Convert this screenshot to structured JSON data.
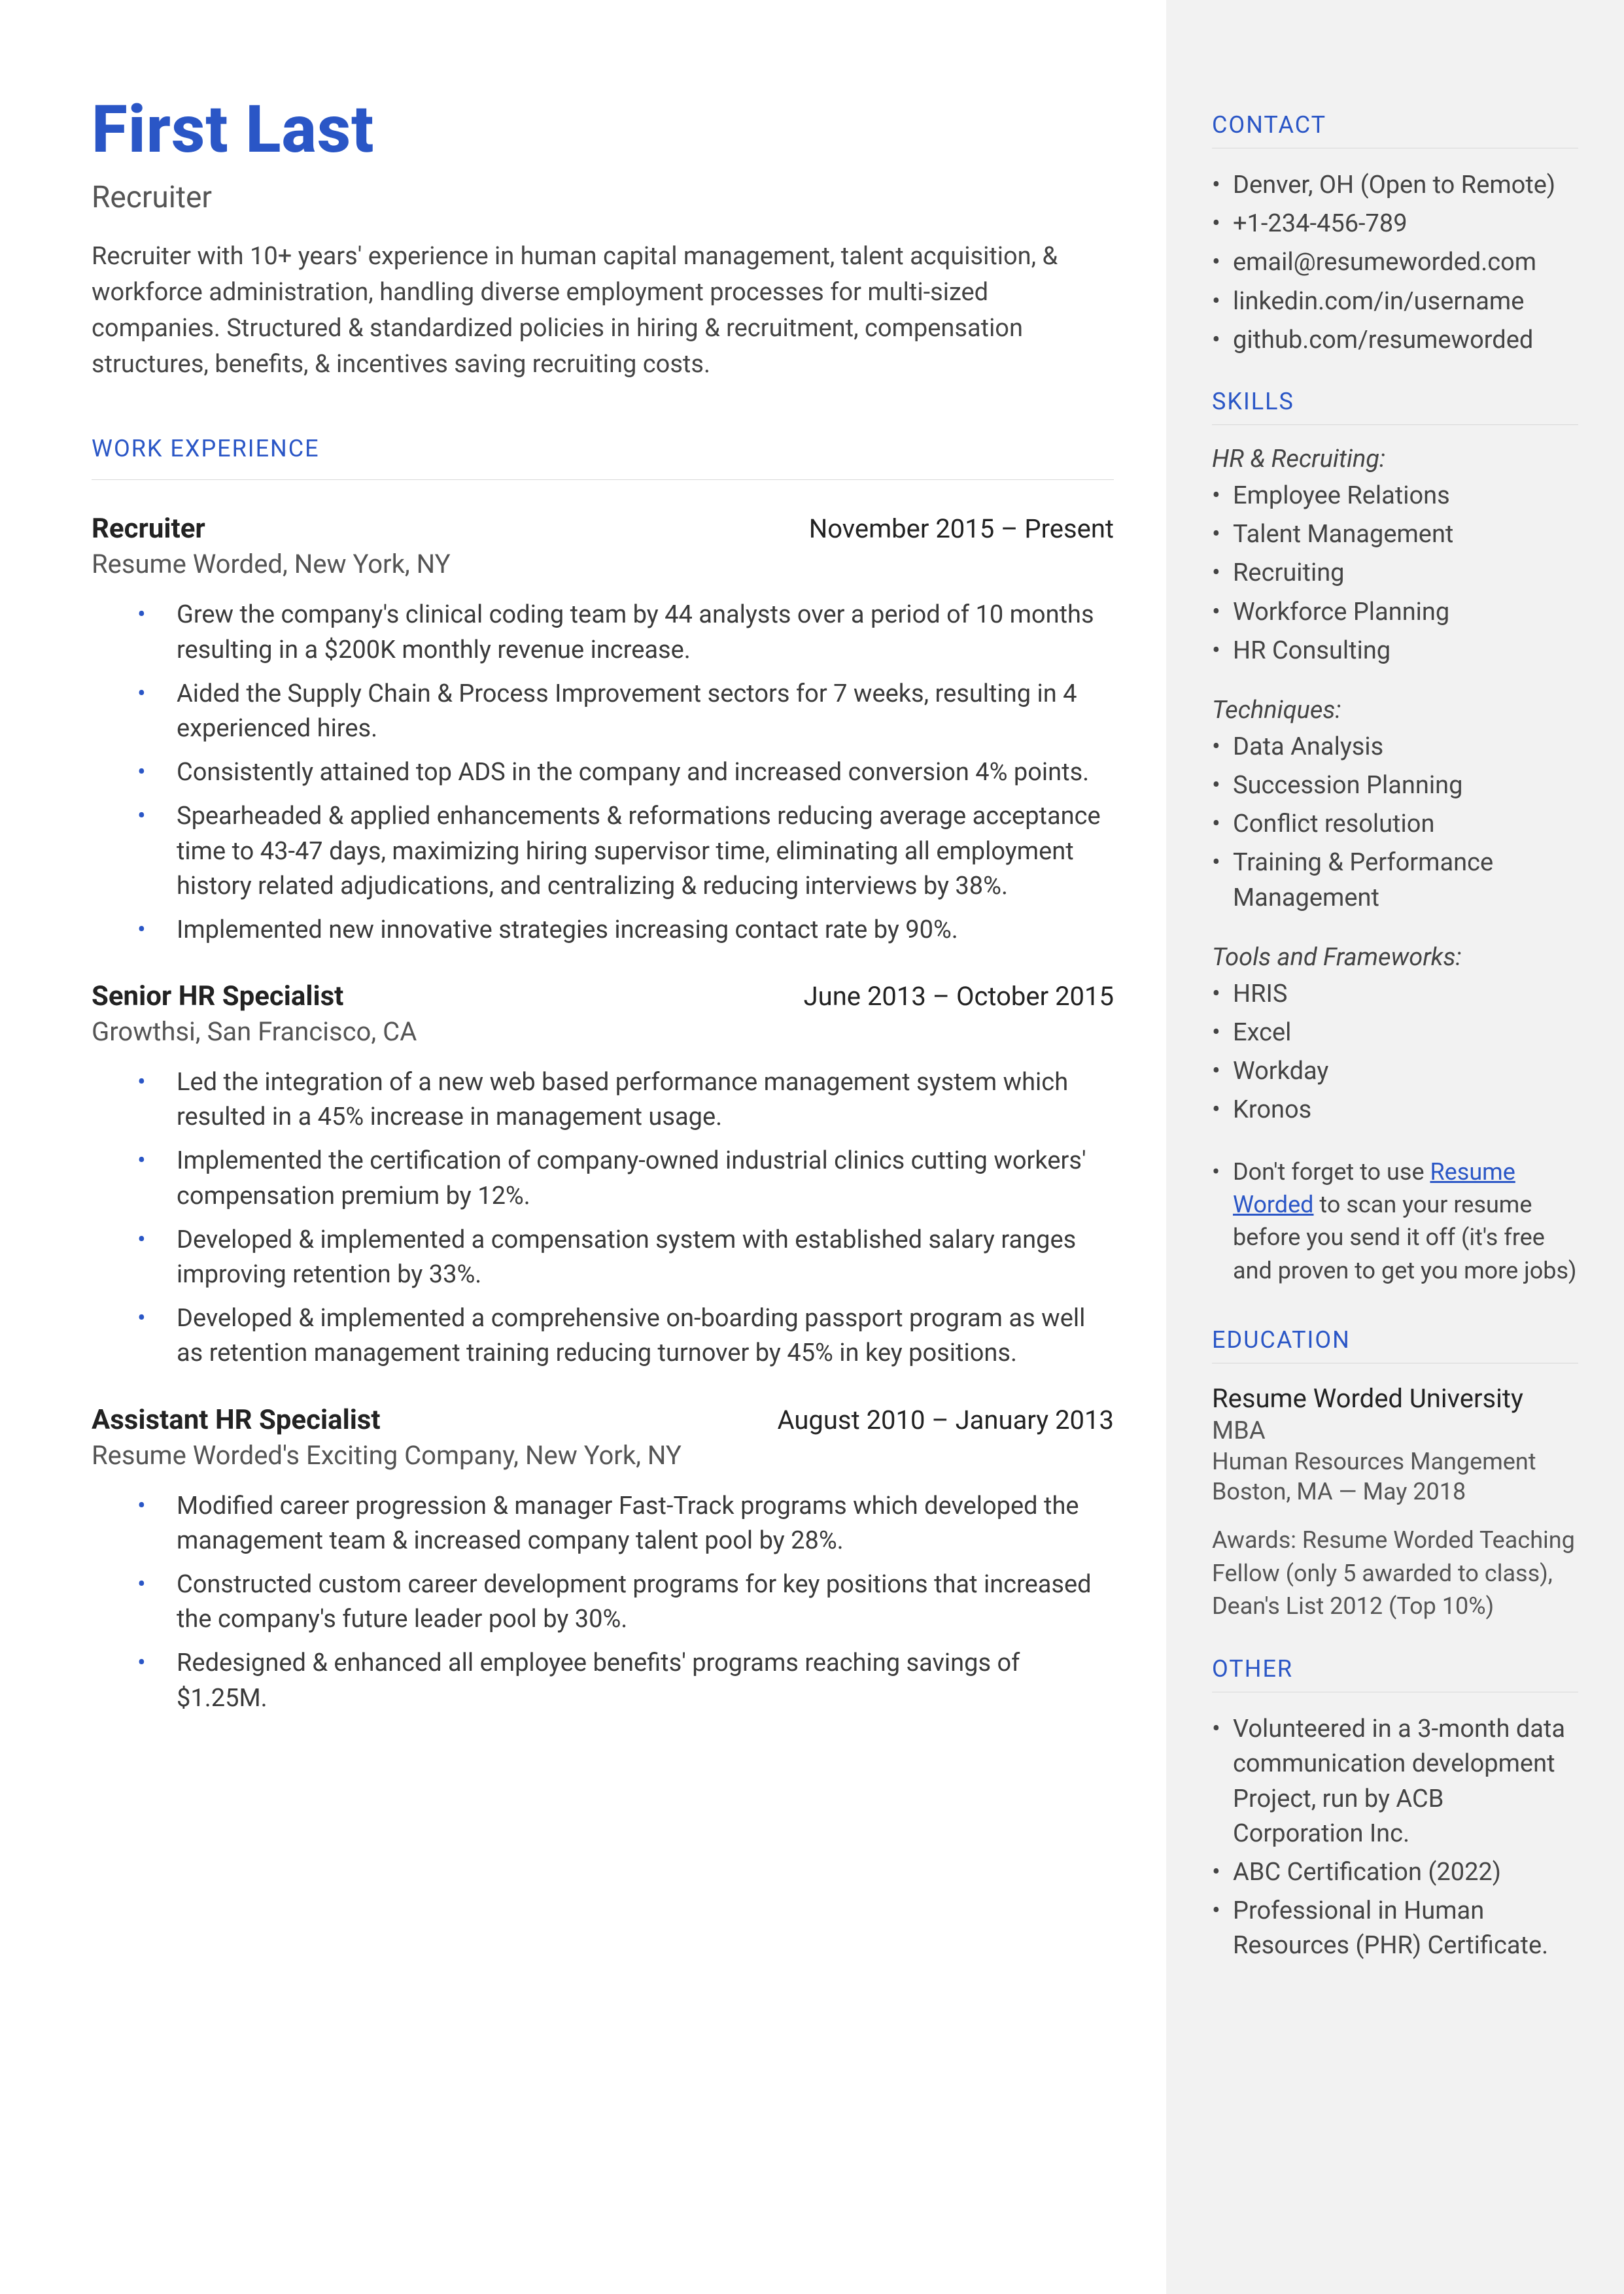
{
  "header": {
    "name": "First Last",
    "role": "Recruiter",
    "summary": "Recruiter with 10+ years' experience in human capital management, talent acquisition, & workforce administration, handling diverse employment processes for multi-sized companies. Structured & standardized policies in hiring & recruitment, compensation structures, benefits, & incentives saving recruiting costs."
  },
  "headings": {
    "work": "WORK EXPERIENCE",
    "contact": "CONTACT",
    "skills": "SKILLS",
    "education": "EDUCATION",
    "other": "OTHER"
  },
  "jobs": [
    {
      "title": "Recruiter",
      "dates": "November 2015 – Present",
      "company": "Resume Worded, New York, NY",
      "bullets": [
        "Grew the company's clinical coding team by 44 analysts over a period of 10 months resulting in a $200K monthly revenue increase.",
        "Aided the Supply Chain & Process Improvement sectors for 7 weeks, resulting in 4 experienced hires.",
        "Consistently attained top ADS in the company and increased conversion 4% points.",
        "Spearheaded & applied enhancements & reformations reducing average acceptance time to 43-47 days, maximizing hiring supervisor time, eliminating all employment history related adjudications, and centralizing & reducing interviews by 38%.",
        "Implemented new innovative strategies increasing contact rate by 90%."
      ]
    },
    {
      "title": "Senior HR Specialist",
      "dates": "June 2013 – October 2015",
      "company": "Growthsi, San Francisco, CA",
      "bullets": [
        "Led the integration of a new web based performance management system which resulted in a 45% increase in management usage.",
        "Implemented the certification of company-owned industrial clinics cutting workers' compensation premium by 12%.",
        "Developed & implemented a compensation system with established salary ranges improving retention by 33%.",
        "Developed & implemented a comprehensive on-boarding passport program as well as retention management training reducing turnover by 45% in key positions."
      ]
    },
    {
      "title": "Assistant HR Specialist",
      "dates": "August 2010 – January 2013",
      "company": "Resume Worded's Exciting Company, New York, NY",
      "bullets": [
        "Modified career progression & manager Fast-Track programs which developed the management team & increased company talent pool by 28%.",
        "Constructed custom career development programs for key positions that increased the company's future leader pool by 30%.",
        "Redesigned & enhanced all employee benefits' programs reaching savings of $1.25M."
      ]
    }
  ],
  "contact": [
    "Denver, OH (Open to Remote)",
    "+1-234-456-789",
    "email@resumeworded.com",
    "linkedin.com/in/username",
    "github.com/resumeworded"
  ],
  "skills": {
    "groups": [
      {
        "label": "HR & Recruiting:",
        "items": [
          "Employee Relations",
          "Talent Management",
          "Recruiting",
          "Workforce Planning",
          "HR Consulting"
        ]
      },
      {
        "label": "Techniques:",
        "items": [
          "Data Analysis",
          "Succession Planning",
          "Conflict resolution",
          "Training & Performance Management"
        ]
      },
      {
        "label": "Tools and Frameworks:",
        "items": [
          "HRIS",
          "Excel",
          "Workday",
          "Kronos"
        ]
      }
    ]
  },
  "tip": {
    "before": "Don't forget to use ",
    "link": "Resume Worded",
    "after": " to scan your resume before you send it off (it's free and proven to get you more jobs)"
  },
  "education": {
    "school": "Resume Worded University",
    "degree": "MBA",
    "field": "Human Resources Mangement",
    "location": "Boston, MA — May 2018",
    "awards": "Awards: Resume Worded Teaching Fellow (only 5 awarded to class), Dean's List 2012 (Top 10%)"
  },
  "other": [
    "Volunteered in a 3-month data communication development Project, run by ACB Corporation Inc.",
    "ABC Certification (2022)",
    "Professional in Human Resources (PHR) Certificate."
  ]
}
